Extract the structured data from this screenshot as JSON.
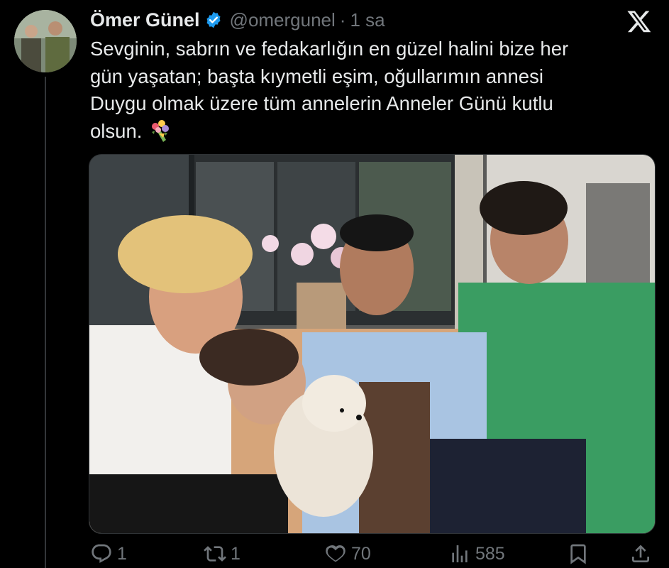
{
  "author": {
    "name": "Ömer Günel",
    "handle": "@omergunel",
    "separator": "·",
    "time": "1 sa",
    "verified_color": "#1d9bf0"
  },
  "tweet": {
    "text": "Sevginin, sabrın ve fedakarlığın en güzel halini bize her\ngün yaşatan; başta kıymetli eşim, oğullarımın annesi\nDuygu olmak üzere tüm annelerin Anneler Günü kutlu\nolsun. ",
    "emoji": "bouquet-emoji"
  },
  "media": {
    "type": "photo",
    "subject": "family-photo"
  },
  "actions": {
    "reply_count": "1",
    "retweet_count": "1",
    "like_count": "70",
    "view_count": "585"
  },
  "icons": {
    "close": "x-logo-icon",
    "reply": "reply-icon",
    "retweet": "retweet-icon",
    "like": "heart-icon",
    "views": "views-icon",
    "bookmark": "bookmark-icon",
    "share": "share-icon"
  }
}
